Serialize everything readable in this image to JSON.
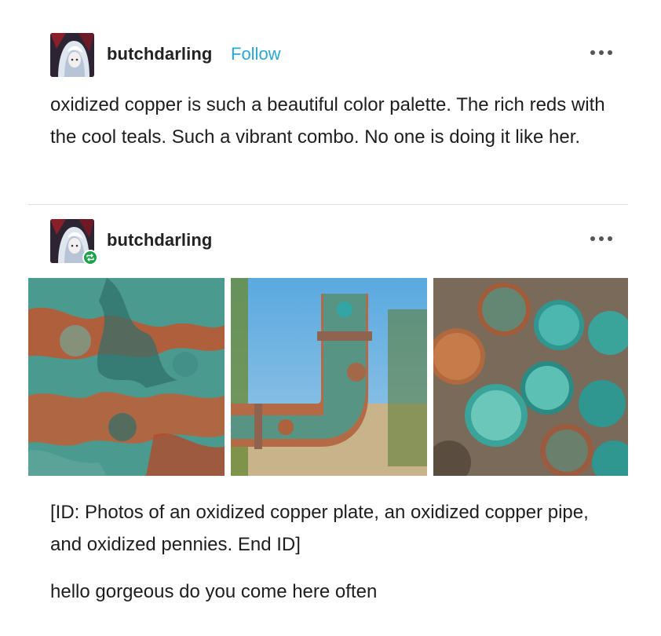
{
  "post": {
    "username": "butchdarling",
    "follow_label": "Follow",
    "text": "oxidized copper is such a beautiful color palette. The rich reds with the cool teals. Such a vibrant combo. No one is doing it like her."
  },
  "reblog": {
    "username": "butchdarling",
    "images": [
      {
        "subject": "oxidized copper plate"
      },
      {
        "subject": "oxidized copper pipe"
      },
      {
        "subject": "oxidized pennies"
      }
    ],
    "image_description": "[ID: Photos of an oxidized copper plate, an oxidized copper pipe, and oxidized pennies. End ID]",
    "comment": "hello gorgeous do you come here often"
  },
  "icons": {
    "more": "more-horizontal-icon",
    "reblog_badge": "reblog-icon"
  },
  "colors": {
    "follow": "#2aa7d6",
    "reblog_badge": "#1ca24b",
    "verdigris": "#3aa39a",
    "copper": "#c0562f"
  }
}
